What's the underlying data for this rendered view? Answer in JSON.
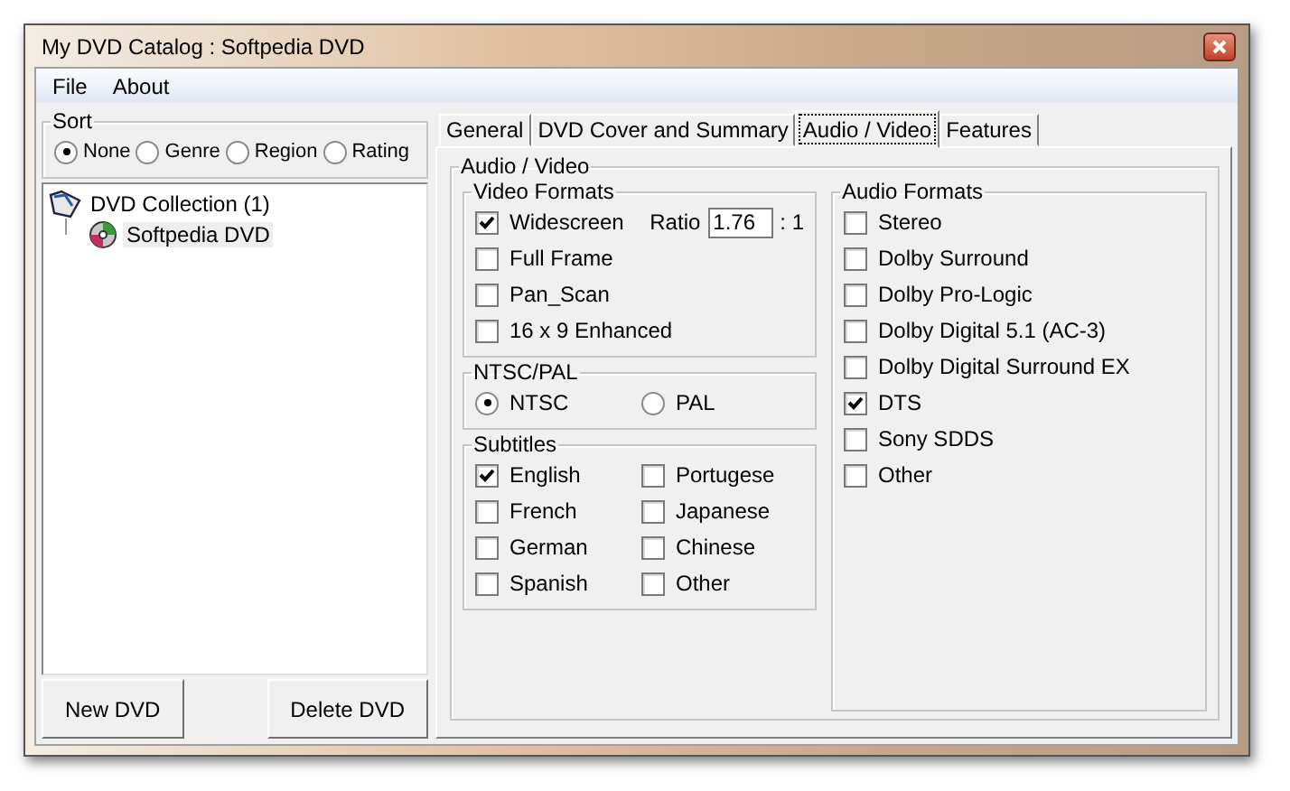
{
  "window": {
    "title": "My DVD Catalog : Softpedia DVD"
  },
  "menu": [
    "File",
    "About"
  ],
  "sort": {
    "title": "Sort",
    "options": [
      {
        "label": "None",
        "selected": true
      },
      {
        "label": "Genre",
        "selected": false
      },
      {
        "label": "Region",
        "selected": false
      },
      {
        "label": "Rating",
        "selected": false
      }
    ]
  },
  "tree": {
    "label": "DVD Collection (1)",
    "children": [
      {
        "label": "Softpedia DVD"
      }
    ]
  },
  "buttons": [
    "New DVD",
    "Delete DVD"
  ],
  "tabs": [
    {
      "label": "General",
      "selected": false
    },
    {
      "label": "DVD Cover and Summary",
      "selected": false
    },
    {
      "label": "Audio / Video",
      "selected": true
    },
    {
      "label": "Features",
      "selected": false
    }
  ],
  "panel": {
    "title": "Audio / Video",
    "video_formats": {
      "title": "Video Formats",
      "ratio": {
        "label": "Ratio",
        "value": "1.76",
        "suffix": ": 1"
      },
      "items": [
        {
          "label": "Widescreen",
          "checked": true
        },
        {
          "label": "Full Frame",
          "checked": false
        },
        {
          "label": "Pan_Scan",
          "checked": false
        },
        {
          "label": "16 x 9 Enhanced",
          "checked": false
        }
      ]
    },
    "ntsc_pal": {
      "title": "NTSC/PAL",
      "options": [
        {
          "label": "NTSC",
          "selected": true
        },
        {
          "label": "PAL",
          "selected": false
        }
      ]
    },
    "subtitles": {
      "title": "Subtitles",
      "items": [
        {
          "label": "English",
          "checked": true
        },
        {
          "label": "Portugese",
          "checked": false
        },
        {
          "label": "French",
          "checked": false
        },
        {
          "label": "Japanese",
          "checked": false
        },
        {
          "label": "German",
          "checked": false
        },
        {
          "label": "Chinese",
          "checked": false
        },
        {
          "label": "Spanish",
          "checked": false
        },
        {
          "label": "Other",
          "checked": false
        }
      ]
    },
    "audio_formats": {
      "title": "Audio Formats",
      "items": [
        {
          "label": "Stereo",
          "checked": false
        },
        {
          "label": "Dolby Surround",
          "checked": false
        },
        {
          "label": "Dolby Pro-Logic",
          "checked": false
        },
        {
          "label": "Dolby Digital 5.1 (AC-3)",
          "checked": false
        },
        {
          "label": "Dolby Digital Surround EX",
          "checked": false
        },
        {
          "label": "DTS",
          "checked": true
        },
        {
          "label": "Sony SDDS",
          "checked": false
        },
        {
          "label": "Other",
          "checked": false
        }
      ]
    }
  }
}
